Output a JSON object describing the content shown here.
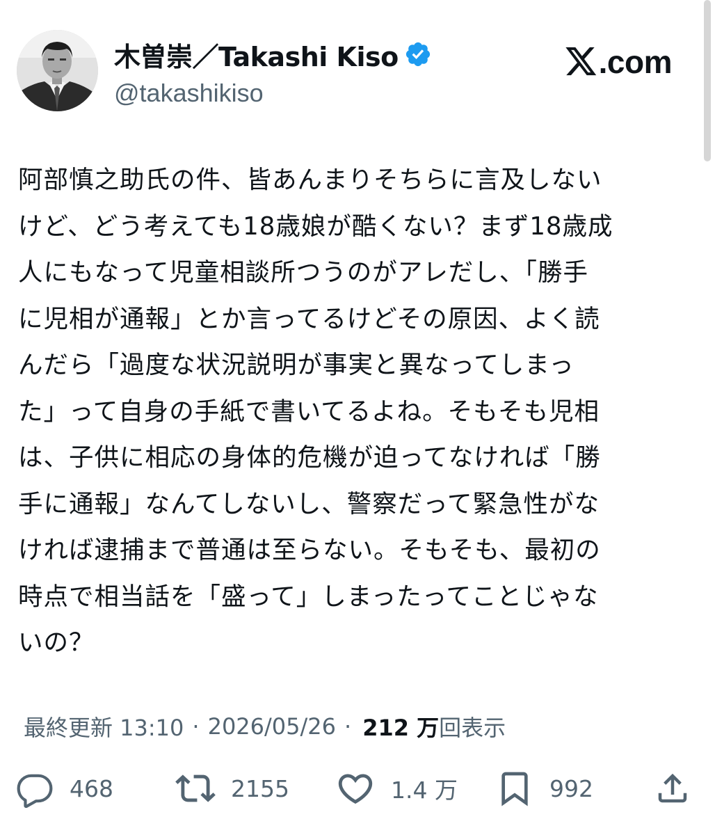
{
  "header": {
    "display_name": "木曽崇／Takashi Kiso",
    "handle": "@takashikiso",
    "site_logo_text": ".com",
    "avatar_icon": "profile-photo",
    "verified_icon": "verified-badge-icon",
    "verified_color": "#1d9bf0"
  },
  "tweet": {
    "text": "阿部慎之助氏の件、皆あんまりそちらに言及しない\nけど、どう考えても18歳娘が酷くない？まず18歳成\n人にもなって児童相談所つうのがアレだし、「勝手\nに児相が通報」とか言ってるけどその原因、よく読\nんだら「過度な状況説明が事実と異なってしまっ\nた」って自身の手紙で書いてるよね。そもそも児相\nは、子供に相応の身体的危機が迫ってなければ「勝\n手に通報」なんてしないし、警察だって緊急性がな\nければ逮捕まで普通は至らない。そもそも、最初の\n時点で相当話を「盛って」しまったってことじゃな\nいの？"
  },
  "meta": {
    "updated_label": "最終更新 13:10",
    "separator": "·",
    "date": "2026/05/26",
    "separator2": "·",
    "views_count": "212 万",
    "views_label": "回表示"
  },
  "actions": {
    "reply_count": "468",
    "retweet_count": "2155",
    "like_count": "1.4 万",
    "bookmark_count": "992"
  },
  "colors": {
    "text_primary": "#0f1419",
    "text_secondary": "#536471",
    "accent": "#1d9bf0"
  }
}
